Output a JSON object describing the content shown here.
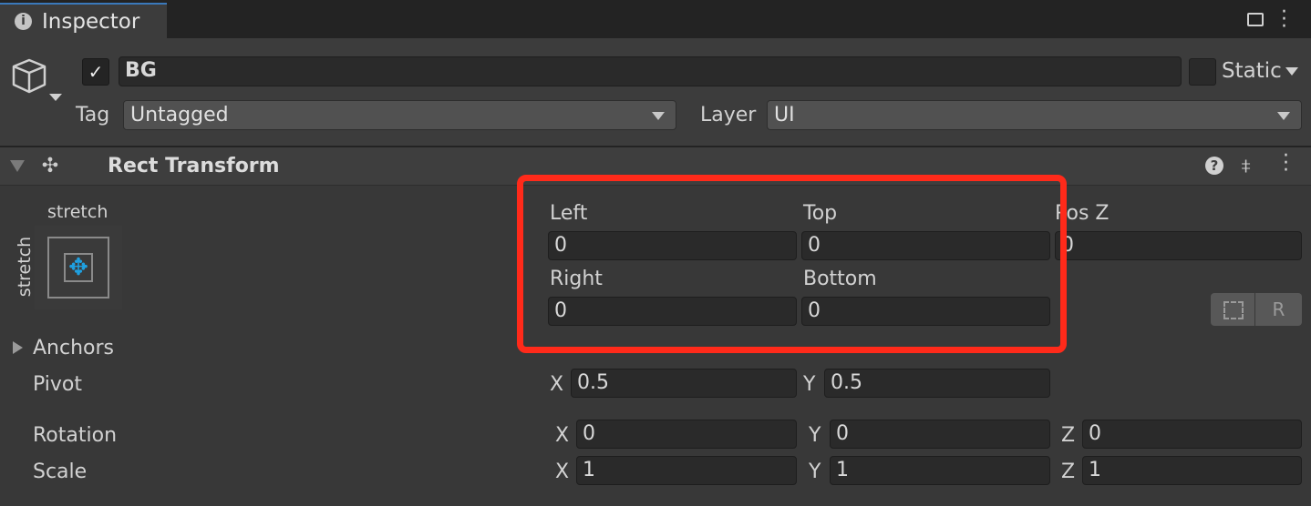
{
  "tab": {
    "title": "Inspector",
    "icon": "info-icon"
  },
  "header_icons": [
    "lock-icon",
    "kebab-menu-icon"
  ],
  "object": {
    "active": true,
    "name": "BG",
    "static_label": "Static",
    "static_checked": false,
    "tag_label": "Tag",
    "tag_value": "Untagged",
    "layer_label": "Layer",
    "layer_value": "UI"
  },
  "component": {
    "title": "Rect Transform",
    "icons": [
      "help-icon",
      "preset-icon",
      "kebab-menu-icon"
    ]
  },
  "anchor_preset": {
    "horizontal": "stretch",
    "vertical": "stretch"
  },
  "rect": {
    "left_label": "Left",
    "left": "0",
    "top_label": "Top",
    "top": "0",
    "posz_label": "Pos Z",
    "posz": "0",
    "right_label": "Right",
    "right": "0",
    "bottom_label": "Bottom",
    "bottom": "0",
    "blueprint_button": "blueprint-mode-icon",
    "raw_button": "R"
  },
  "anchors_label": "Anchors",
  "pivot": {
    "label": "Pivot",
    "x_label": "X",
    "x": "0.5",
    "y_label": "Y",
    "y": "0.5"
  },
  "rotation": {
    "label": "Rotation",
    "x_label": "X",
    "x": "0",
    "y_label": "Y",
    "y": "0",
    "z_label": "Z",
    "z": "0"
  },
  "scale": {
    "label": "Scale",
    "x_label": "X",
    "x": "1",
    "y_label": "Y",
    "y": "1",
    "z_label": "Z",
    "z": "1"
  },
  "highlight_color": "#ff2a1a"
}
